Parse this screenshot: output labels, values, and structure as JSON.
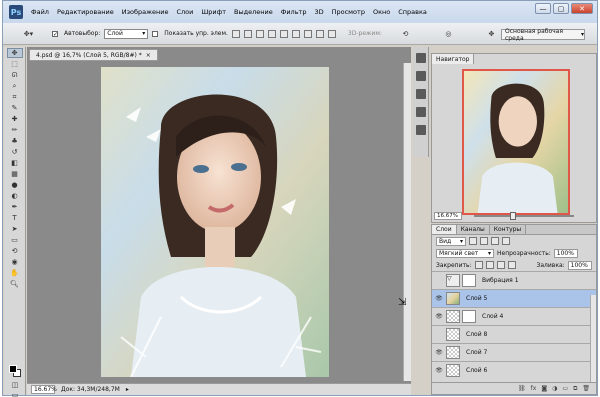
{
  "app": {
    "logo": "Ps",
    "menu": [
      "Файл",
      "Редактирование",
      "Изображение",
      "Слои",
      "Шрифт",
      "Выделение",
      "Фильтр",
      "3D",
      "Просмотр",
      "Окно",
      "Справка"
    ],
    "window_buttons": [
      "—",
      "▢",
      "✕"
    ]
  },
  "options": {
    "autoselect_label": "Автовыбор:",
    "autoselect_value": "Слой",
    "show_controls_label": "Показать упр. элем.",
    "mode_3d_label": "3D-режим:",
    "workspace": "Основная рабочая среда"
  },
  "document": {
    "tab_title": "4.psd @ 16,7% (Слой 5, RGB/8#) *",
    "tab_close": "×",
    "zoom": "16.67%",
    "doc_size": "Док: 34,3M/248,7M"
  },
  "navigator": {
    "tab": "Навигатор",
    "zoom": "16.67%"
  },
  "layers": {
    "tabs": [
      "Слои",
      "Каналы",
      "Контуры"
    ],
    "filter_kind": "Вид",
    "blend_mode": "Мягкий свет",
    "opacity_label": "Непрозрачность:",
    "opacity_value": "100%",
    "lock_label": "Закрепить:",
    "fill_label": "Заливка:",
    "fill_value": "100%",
    "items": [
      {
        "name": "Вибрация 1",
        "visible": false,
        "selected": false
      },
      {
        "name": "Слой 5",
        "visible": true,
        "selected": true
      },
      {
        "name": "Слой 4",
        "visible": true,
        "selected": false
      },
      {
        "name": "Слой 8",
        "visible": false,
        "selected": false
      },
      {
        "name": "Слой 7",
        "visible": true,
        "selected": false
      },
      {
        "name": "Слой 6",
        "visible": true,
        "selected": false
      }
    ],
    "bottom_icons": [
      "link-icon",
      "fx-icon",
      "mask-icon",
      "adjustment-icon",
      "folder-icon",
      "new-layer-icon",
      "trash-icon"
    ]
  },
  "colors": {
    "selected_layer": "#a9c3e9",
    "nav_frame": "#e0574a"
  }
}
